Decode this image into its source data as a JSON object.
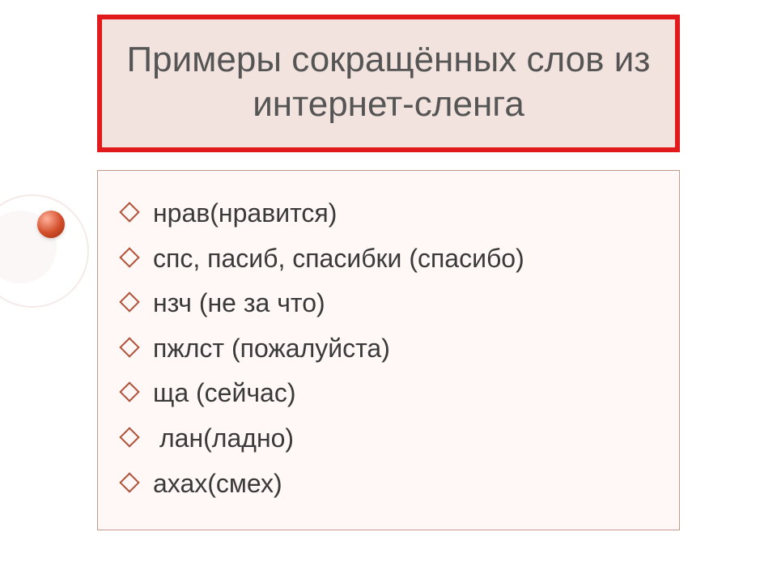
{
  "title": "Примеры сокращённых слов из интернет-сленга",
  "items": [
    "нрав(нравится)",
    "спс, пасиб, спасибки (спасибо)",
    "нзч (не за что)",
    "пжлст (пожалуйста)",
    "ща (сейчас)",
    " лан(ладно)",
    "ахах(смех)"
  ]
}
